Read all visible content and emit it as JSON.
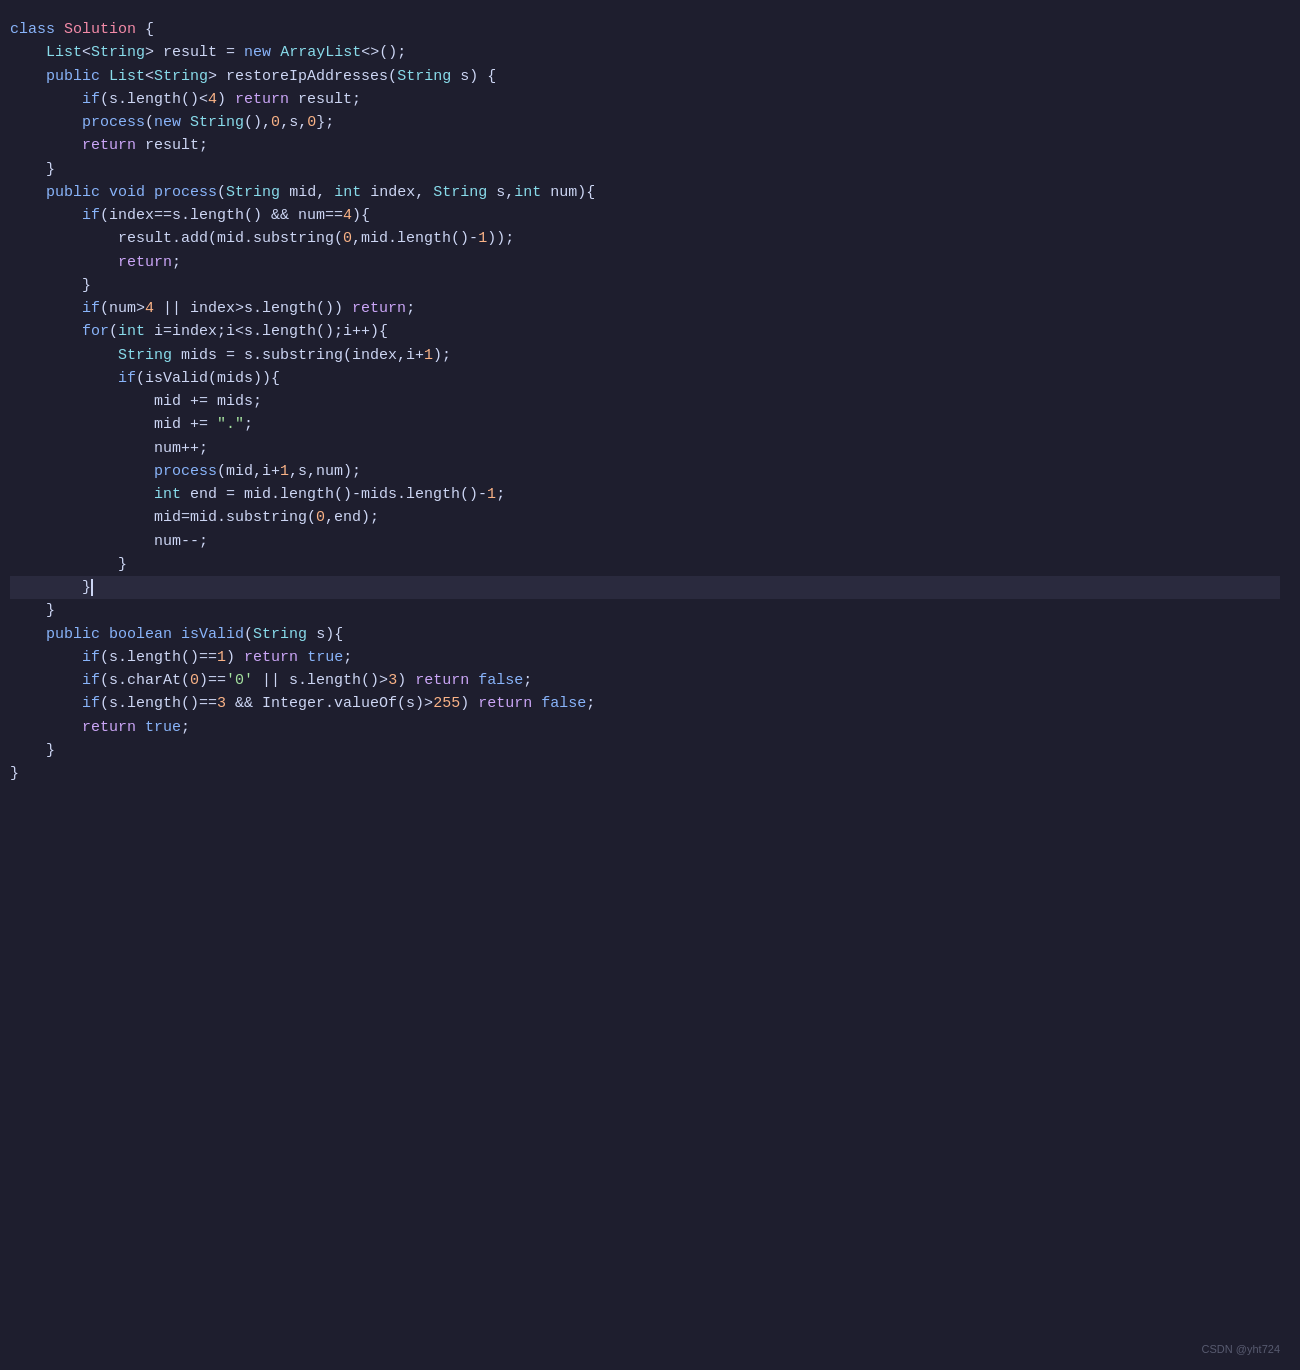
{
  "watermark": "CSDN @yht724",
  "code": {
    "lines": [
      {
        "id": 1,
        "tokens": [
          {
            "t": "class",
            "c": "kw"
          },
          {
            "t": " ",
            "c": "plain"
          },
          {
            "t": "Solution",
            "c": "class-name"
          },
          {
            "t": " {",
            "c": "plain"
          }
        ]
      },
      {
        "id": 2,
        "tokens": [
          {
            "t": "    ",
            "c": "plain"
          },
          {
            "t": "List",
            "c": "type"
          },
          {
            "t": "<",
            "c": "plain"
          },
          {
            "t": "String",
            "c": "type"
          },
          {
            "t": "> result = ",
            "c": "plain"
          },
          {
            "t": "new",
            "c": "kw"
          },
          {
            "t": " ",
            "c": "plain"
          },
          {
            "t": "ArrayList",
            "c": "type"
          },
          {
            "t": "<>();",
            "c": "plain"
          }
        ]
      },
      {
        "id": 3,
        "tokens": [
          {
            "t": "    ",
            "c": "plain"
          },
          {
            "t": "public",
            "c": "kw"
          },
          {
            "t": " ",
            "c": "plain"
          },
          {
            "t": "List",
            "c": "type"
          },
          {
            "t": "<",
            "c": "plain"
          },
          {
            "t": "String",
            "c": "type"
          },
          {
            "t": "> restoreIpAddresses(",
            "c": "plain"
          },
          {
            "t": "String",
            "c": "type"
          },
          {
            "t": " s) {",
            "c": "plain"
          }
        ]
      },
      {
        "id": 4,
        "tokens": [
          {
            "t": "        ",
            "c": "plain"
          },
          {
            "t": "if",
            "c": "kw"
          },
          {
            "t": "(s.length()<",
            "c": "plain"
          },
          {
            "t": "4",
            "c": "num"
          },
          {
            "t": ") ",
            "c": "plain"
          },
          {
            "t": "return",
            "c": "kw2"
          },
          {
            "t": " result;",
            "c": "plain"
          }
        ]
      },
      {
        "id": 5,
        "tokens": [
          {
            "t": "        ",
            "c": "plain"
          },
          {
            "t": "process",
            "c": "fn"
          },
          {
            "t": "(",
            "c": "plain"
          },
          {
            "t": "new",
            "c": "kw"
          },
          {
            "t": " ",
            "c": "plain"
          },
          {
            "t": "String",
            "c": "type"
          },
          {
            "t": "(),",
            "c": "plain"
          },
          {
            "t": "0",
            "c": "num"
          },
          {
            "t": ",s,",
            "c": "plain"
          },
          {
            "t": "0",
            "c": "num"
          },
          {
            "t": "};",
            "c": "plain"
          }
        ]
      },
      {
        "id": 6,
        "tokens": [
          {
            "t": "        ",
            "c": "plain"
          },
          {
            "t": "return",
            "c": "kw2"
          },
          {
            "t": " result;",
            "c": "plain"
          }
        ]
      },
      {
        "id": 7,
        "tokens": [
          {
            "t": "    }",
            "c": "plain"
          }
        ]
      },
      {
        "id": 8,
        "tokens": [
          {
            "t": "    ",
            "c": "plain"
          },
          {
            "t": "public",
            "c": "kw"
          },
          {
            "t": " ",
            "c": "plain"
          },
          {
            "t": "void",
            "c": "kw"
          },
          {
            "t": " ",
            "c": "plain"
          },
          {
            "t": "process",
            "c": "fn"
          },
          {
            "t": "(",
            "c": "plain"
          },
          {
            "t": "String",
            "c": "type"
          },
          {
            "t": " mid, ",
            "c": "plain"
          },
          {
            "t": "int",
            "c": "type"
          },
          {
            "t": " index, ",
            "c": "plain"
          },
          {
            "t": "String",
            "c": "type"
          },
          {
            "t": " s,",
            "c": "plain"
          },
          {
            "t": "int",
            "c": "type"
          },
          {
            "t": " num){",
            "c": "plain"
          }
        ]
      },
      {
        "id": 9,
        "tokens": [
          {
            "t": "        ",
            "c": "plain"
          },
          {
            "t": "if",
            "c": "kw"
          },
          {
            "t": "(index==s.length() && num==",
            "c": "plain"
          },
          {
            "t": "4",
            "c": "num"
          },
          {
            "t": "){",
            "c": "plain"
          }
        ]
      },
      {
        "id": 10,
        "tokens": [
          {
            "t": "            ",
            "c": "plain"
          },
          {
            "t": "result",
            "c": "plain"
          },
          {
            "t": ".add(mid.substring(",
            "c": "plain"
          },
          {
            "t": "0",
            "c": "num"
          },
          {
            "t": ",mid.length()-",
            "c": "plain"
          },
          {
            "t": "1",
            "c": "num"
          },
          {
            "t": "));",
            "c": "plain"
          }
        ]
      },
      {
        "id": 11,
        "tokens": [
          {
            "t": "            ",
            "c": "plain"
          },
          {
            "t": "return",
            "c": "kw2"
          },
          {
            "t": ";",
            "c": "plain"
          }
        ]
      },
      {
        "id": 12,
        "tokens": [
          {
            "t": "        }",
            "c": "plain"
          }
        ]
      },
      {
        "id": 13,
        "tokens": [
          {
            "t": "        ",
            "c": "plain"
          },
          {
            "t": "if",
            "c": "kw"
          },
          {
            "t": "(num>",
            "c": "plain"
          },
          {
            "t": "4",
            "c": "num"
          },
          {
            "t": " || index>s.length()) ",
            "c": "plain"
          },
          {
            "t": "return",
            "c": "kw2"
          },
          {
            "t": ";",
            "c": "plain"
          }
        ]
      },
      {
        "id": 14,
        "tokens": [
          {
            "t": "        ",
            "c": "plain"
          },
          {
            "t": "for",
            "c": "kw"
          },
          {
            "t": "(",
            "c": "plain"
          },
          {
            "t": "int",
            "c": "type"
          },
          {
            "t": " i=index;i<s.length();i++){",
            "c": "plain"
          }
        ]
      },
      {
        "id": 15,
        "tokens": [
          {
            "t": "            ",
            "c": "plain"
          },
          {
            "t": "String",
            "c": "type"
          },
          {
            "t": " mids = s.substring(index,i+",
            "c": "plain"
          },
          {
            "t": "1",
            "c": "num"
          },
          {
            "t": ");",
            "c": "plain"
          }
        ]
      },
      {
        "id": 16,
        "tokens": [
          {
            "t": "            ",
            "c": "plain"
          },
          {
            "t": "if",
            "c": "kw"
          },
          {
            "t": "(isValid(mids)){",
            "c": "plain"
          }
        ]
      },
      {
        "id": 17,
        "tokens": [
          {
            "t": "                ",
            "c": "plain"
          },
          {
            "t": "mid += mids;",
            "c": "plain"
          }
        ]
      },
      {
        "id": 18,
        "tokens": [
          {
            "t": "                ",
            "c": "plain"
          },
          {
            "t": "mid += ",
            "c": "plain"
          },
          {
            "t": "\".\"",
            "c": "str"
          },
          {
            "t": ";",
            "c": "plain"
          }
        ]
      },
      {
        "id": 19,
        "tokens": [
          {
            "t": "                ",
            "c": "plain"
          },
          {
            "t": "num++;",
            "c": "plain"
          }
        ]
      },
      {
        "id": 20,
        "tokens": [
          {
            "t": "                ",
            "c": "plain"
          },
          {
            "t": "process",
            "c": "fn"
          },
          {
            "t": "(mid,i+",
            "c": "plain"
          },
          {
            "t": "1",
            "c": "num"
          },
          {
            "t": ",s,num);",
            "c": "plain"
          }
        ]
      },
      {
        "id": 21,
        "tokens": [
          {
            "t": "                ",
            "c": "plain"
          },
          {
            "t": "int",
            "c": "type"
          },
          {
            "t": " end = mid.length()-mids.length()-",
            "c": "plain"
          },
          {
            "t": "1",
            "c": "num"
          },
          {
            "t": ";",
            "c": "plain"
          }
        ]
      },
      {
        "id": 22,
        "tokens": [
          {
            "t": "                ",
            "c": "plain"
          },
          {
            "t": "mid=mid.substring(",
            "c": "plain"
          },
          {
            "t": "0",
            "c": "num"
          },
          {
            "t": ",end);",
            "c": "plain"
          }
        ]
      },
      {
        "id": 23,
        "tokens": [
          {
            "t": "                ",
            "c": "plain"
          },
          {
            "t": "num--;",
            "c": "plain"
          }
        ]
      },
      {
        "id": 24,
        "tokens": [
          {
            "t": "            }",
            "c": "plain"
          }
        ]
      },
      {
        "id": 25,
        "tokens": [
          {
            "t": "        ",
            "c": "plain"
          },
          {
            "t": "}",
            "c": "plain"
          },
          {
            "t": "|",
            "c": "cursor"
          }
        ],
        "highlight": true
      },
      {
        "id": 26,
        "tokens": [
          {
            "t": "    }",
            "c": "plain"
          }
        ]
      },
      {
        "id": 27,
        "tokens": [
          {
            "t": "    ",
            "c": "plain"
          },
          {
            "t": "public",
            "c": "kw"
          },
          {
            "t": " ",
            "c": "plain"
          },
          {
            "t": "boolean",
            "c": "kw"
          },
          {
            "t": " ",
            "c": "plain"
          },
          {
            "t": "isValid",
            "c": "fn"
          },
          {
            "t": "(",
            "c": "plain"
          },
          {
            "t": "String",
            "c": "type"
          },
          {
            "t": " s){",
            "c": "plain"
          }
        ]
      },
      {
        "id": 28,
        "tokens": [
          {
            "t": "        ",
            "c": "plain"
          },
          {
            "t": "if",
            "c": "kw"
          },
          {
            "t": "(s.length()==",
            "c": "plain"
          },
          {
            "t": "1",
            "c": "num"
          },
          {
            "t": ") ",
            "c": "plain"
          },
          {
            "t": "return",
            "c": "kw2"
          },
          {
            "t": " ",
            "c": "plain"
          },
          {
            "t": "true",
            "c": "kw"
          },
          {
            "t": ";",
            "c": "plain"
          }
        ]
      },
      {
        "id": 29,
        "tokens": [
          {
            "t": "        ",
            "c": "plain"
          },
          {
            "t": "if",
            "c": "kw"
          },
          {
            "t": "(s.charAt(",
            "c": "plain"
          },
          {
            "t": "0",
            "c": "num"
          },
          {
            "t": ")==",
            "c": "plain"
          },
          {
            "t": "'0'",
            "c": "str"
          },
          {
            "t": " || s.length()>",
            "c": "plain"
          },
          {
            "t": "3",
            "c": "num"
          },
          {
            "t": ") ",
            "c": "plain"
          },
          {
            "t": "return",
            "c": "kw2"
          },
          {
            "t": " ",
            "c": "plain"
          },
          {
            "t": "false",
            "c": "kw"
          },
          {
            "t": ";",
            "c": "plain"
          }
        ]
      },
      {
        "id": 30,
        "tokens": [
          {
            "t": "        ",
            "c": "plain"
          },
          {
            "t": "if",
            "c": "kw"
          },
          {
            "t": "(s.length()==",
            "c": "plain"
          },
          {
            "t": "3",
            "c": "num"
          },
          {
            "t": " && Integer.valueOf(s)>",
            "c": "plain"
          },
          {
            "t": "255",
            "c": "num"
          },
          {
            "t": ") ",
            "c": "plain"
          },
          {
            "t": "return",
            "c": "kw2"
          },
          {
            "t": " ",
            "c": "plain"
          },
          {
            "t": "false",
            "c": "kw"
          },
          {
            "t": ";",
            "c": "plain"
          }
        ]
      },
      {
        "id": 31,
        "tokens": [
          {
            "t": "        ",
            "c": "plain"
          },
          {
            "t": "return",
            "c": "kw2"
          },
          {
            "t": " ",
            "c": "plain"
          },
          {
            "t": "true",
            "c": "kw"
          },
          {
            "t": ";",
            "c": "plain"
          }
        ]
      },
      {
        "id": 32,
        "tokens": [
          {
            "t": "    }",
            "c": "plain"
          }
        ]
      },
      {
        "id": 33,
        "tokens": [
          {
            "t": "}",
            "c": "plain"
          }
        ]
      }
    ]
  }
}
